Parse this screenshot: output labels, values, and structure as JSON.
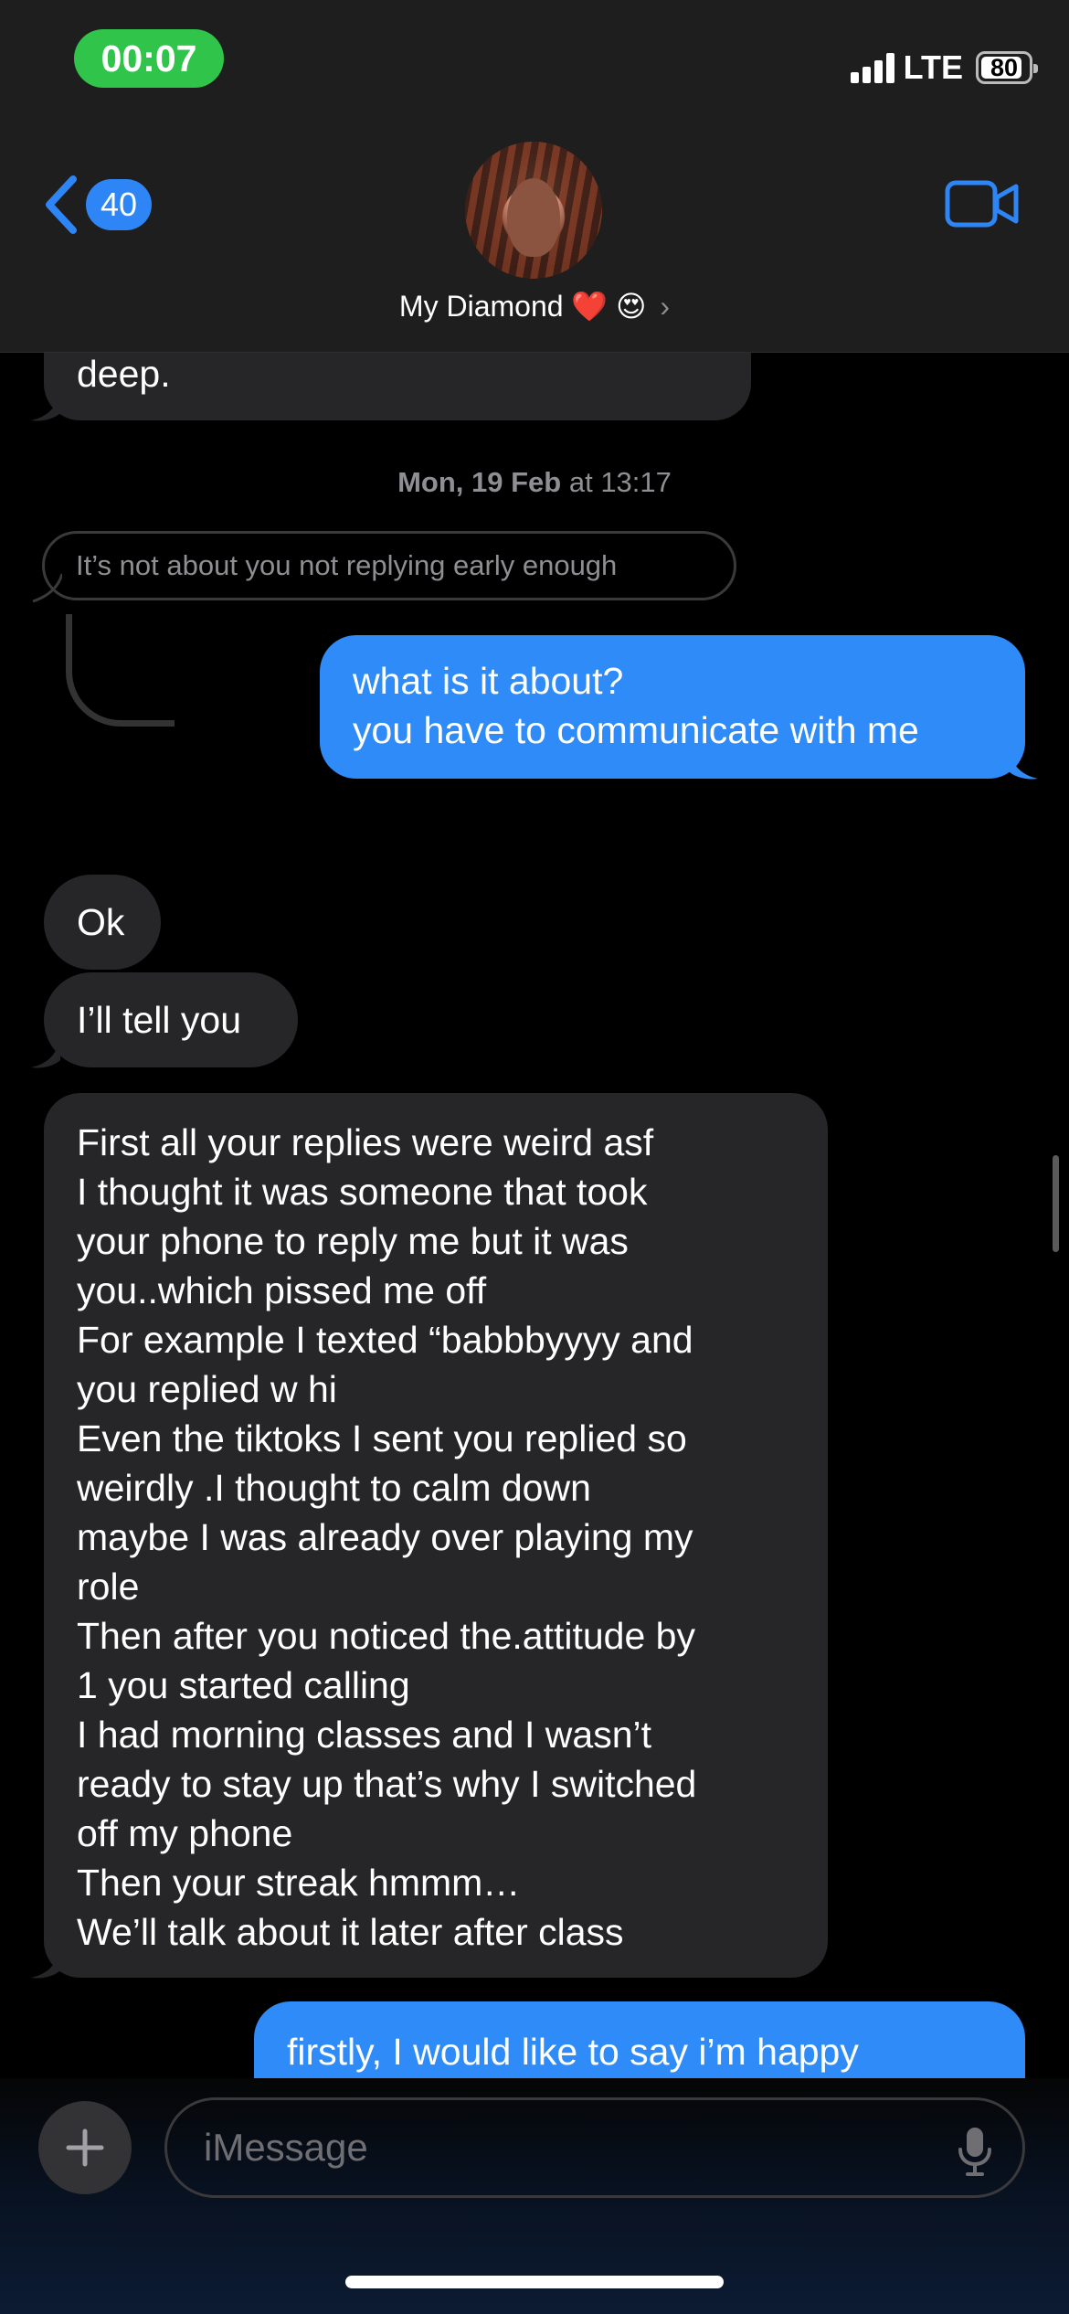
{
  "status_bar": {
    "time": "00:07",
    "network": "LTE",
    "battery": "80"
  },
  "header": {
    "back_count": "40",
    "contact_name": "My Diamond",
    "contact_emoji": "❤️ 😍",
    "chevron": "›"
  },
  "messages": {
    "partial_top": "deep.",
    "timestamp_day": "Mon, 19 Feb",
    "timestamp_time": " at 13:17",
    "reply_quote": "It’s not about you not replying early enough",
    "out_1": [
      "what is it about?",
      "you have to communicate with me"
    ],
    "in_ok": "Ok",
    "in_tell": "I’ll tell you",
    "in_long": [
      "First all your replies were weird asf",
      "I thought it was someone that took",
      "your phone to reply me but it was",
      "you..which pissed me off",
      "For example I texted “babbbyyyy and",
      "you replied w hi",
      "Even the tiktoks I sent you replied so",
      "weirdly .I thought to calm down",
      "maybe I was already over playing my",
      "role",
      "Then after you noticed the.attitude by",
      "1 you started calling",
      "I had morning classes and I wasn’t",
      "ready to stay up that’s why I switched",
      "off my phone",
      "Then your streak hmmm…",
      "We’ll talk about it later after class"
    ],
    "out_partial": "firstly, I would like to say i’m happy"
  },
  "input": {
    "placeholder": "iMessage"
  },
  "colors": {
    "outgoing": "#2f8bf7",
    "incoming": "#262628",
    "time_pill": "#30c44a"
  }
}
